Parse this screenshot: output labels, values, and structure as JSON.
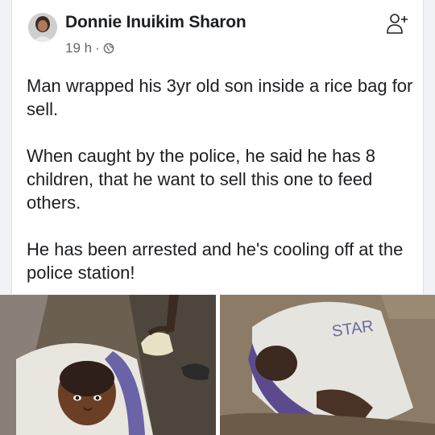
{
  "post": {
    "author": "Donnie Inuikim Sharon",
    "time": "19 h",
    "separator": "·",
    "privacy_icon": "globe-icon",
    "follow_icon": "add-friend-icon",
    "paragraphs": [
      "Man wrapped his 3yr old son inside a rice bag for sell.",
      "When caught by the police, he said he has 8 children, that he want to sell this one to feed others.",
      "He has been arrested and he's cooling off at the police station!"
    ]
  },
  "photos": {
    "right": {
      "bag_print": "STAR"
    }
  },
  "colors": {
    "text": "#1c1e21",
    "secondary": "#65676b",
    "background": "#f0f2f5"
  }
}
